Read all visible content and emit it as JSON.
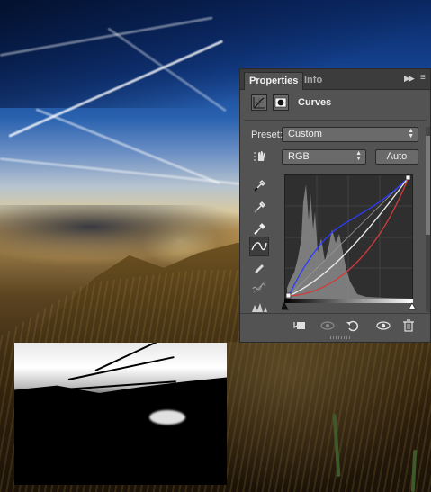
{
  "properties_panel": {
    "tabs": [
      {
        "label": "Properties",
        "active": true
      },
      {
        "label": "Info",
        "active": false
      }
    ],
    "adjustment_title": "Curves",
    "preset": {
      "label": "Preset:",
      "value": "Custom"
    },
    "channel": {
      "value": "RGB"
    },
    "auto_button": {
      "label": "Auto"
    },
    "tools": [
      "eyedropper-black-icon",
      "eyedropper-gray-icon",
      "eyedropper-white-icon",
      "curve-point-tool-icon",
      "pencil-icon",
      "smooth-curve-icon",
      "clipping-warning-icon"
    ],
    "bottom_icons": [
      "clip-to-layer-icon",
      "view-previous-state-icon",
      "reset-icon",
      "visibility-icon",
      "trash-icon"
    ],
    "colors": {
      "panel": "#535353",
      "graph": "#2f2f2f",
      "blue_curve": "#2b3cff",
      "red_curve": "#d43a3a",
      "rgb_curve": "#e8e8e8"
    }
  },
  "canvas": {
    "mask_thumbnail": "black-and-white mask preview"
  }
}
